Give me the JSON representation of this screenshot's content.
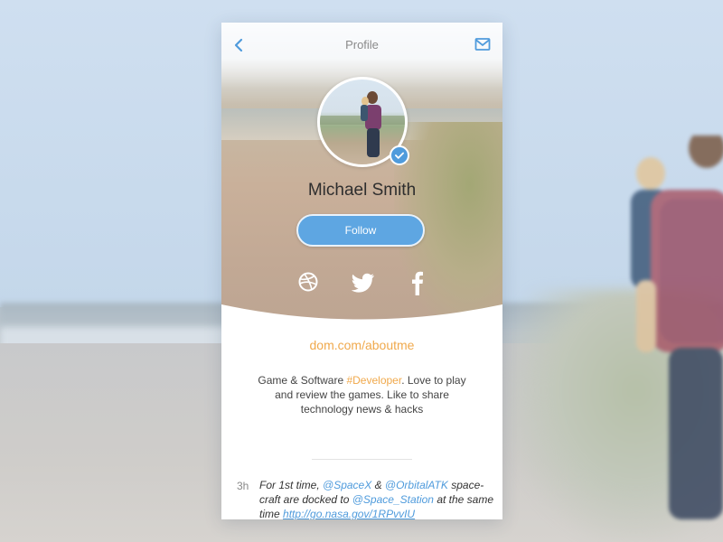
{
  "header": {
    "title": "Profile",
    "back_icon": "chevron-left-icon",
    "mail_icon": "mail-icon"
  },
  "profile": {
    "name": "Michael Smith",
    "follow_label": "Follow",
    "verified": true,
    "link": "dom.com/aboutme",
    "bio_before": "Game & Software ",
    "bio_tag": "#Developer",
    "bio_after": ". Love to play and review the games. Like to share technology news & hacks"
  },
  "social": [
    {
      "name": "dribbble-icon"
    },
    {
      "name": "twitter-icon"
    },
    {
      "name": "facebook-icon"
    }
  ],
  "tweet": {
    "time": "3h",
    "t1": "For 1st time, ",
    "m1": "@SpaceX",
    "t2": " & ",
    "m2": "@OrbitalATK",
    "t3": " space-craft are docked to ",
    "m3": "@Space_Station",
    "t4": " at the same time ",
    "url": "http://go.nasa.gov/1RPvvIU"
  },
  "colors": {
    "accent_blue": "#5ea6e2",
    "link_orange": "#f0a94c",
    "text_dark": "#2e2e2e"
  }
}
